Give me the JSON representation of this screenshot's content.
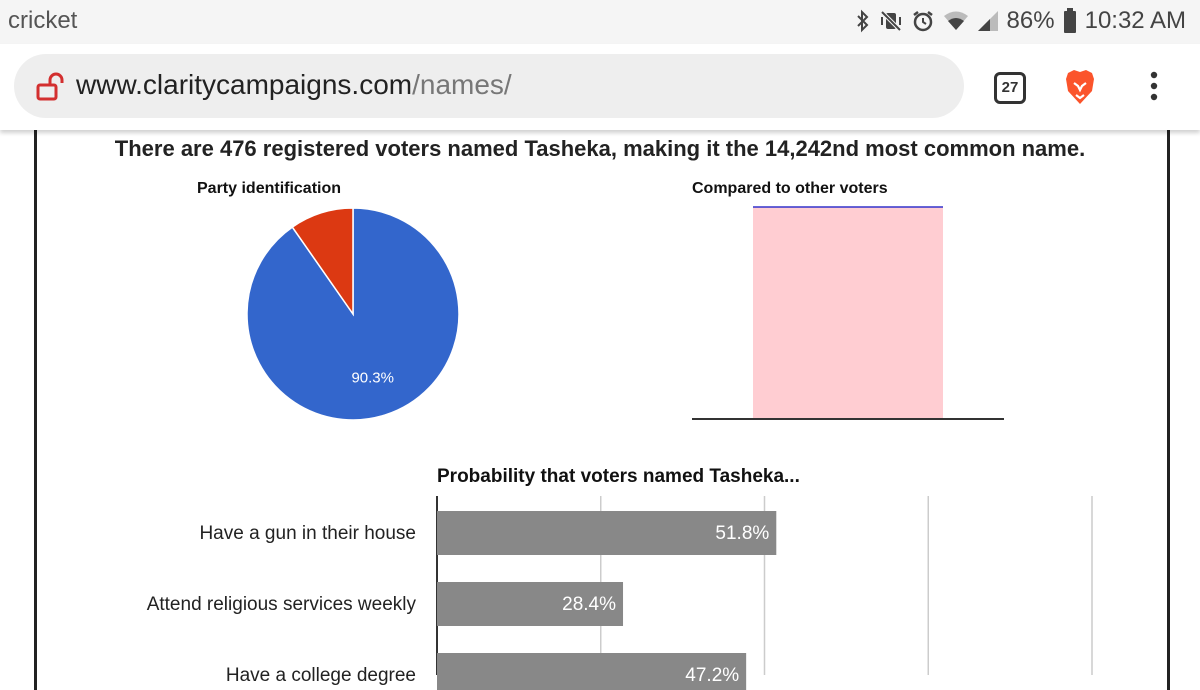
{
  "status_bar": {
    "carrier": "cricket",
    "battery": "86%",
    "time": "10:32 AM",
    "icons": [
      "bluetooth-icon",
      "vibrate-mute-icon",
      "alarm-icon",
      "wifi-icon",
      "signal-icon",
      "battery-icon"
    ]
  },
  "browser": {
    "url_domain": "www.claritycampaigns.com",
    "url_path": "/names/",
    "tab_count": "27",
    "icons": [
      "unlocked-icon",
      "brave-lion-icon",
      "overflow-menu-icon"
    ]
  },
  "page": {
    "headline": "There are 476 registered voters named Tasheka, making it the 14,242nd most common name."
  },
  "colors": {
    "democrat_blue": "#3366cc",
    "republican_red": "#dc3912",
    "bar_gray": "#888888",
    "compare_fill": "#ffcdd2",
    "compare_line": "#3333cc"
  },
  "chart_data": [
    {
      "type": "pie",
      "title": "Party identification",
      "slices": [
        {
          "value": 90.3,
          "label": "90.3%",
          "color": "#3366cc"
        },
        {
          "value": 9.7,
          "label": "",
          "color": "#dc3912"
        }
      ]
    },
    {
      "type": "area",
      "title": "Compared to other voters",
      "note": "filled region spans the full plotted height"
    },
    {
      "type": "bar",
      "orientation": "horizontal",
      "title": "Probability that voters named Tasheka...",
      "categories": [
        "Have a gun in their house",
        "Attend religious services weekly",
        "Have a college degree"
      ],
      "values": [
        51.8,
        28.4,
        47.2
      ],
      "value_labels": [
        "51.8%",
        "28.4%",
        "47.2%"
      ],
      "xlim": [
        0,
        100
      ],
      "grid": true
    }
  ]
}
